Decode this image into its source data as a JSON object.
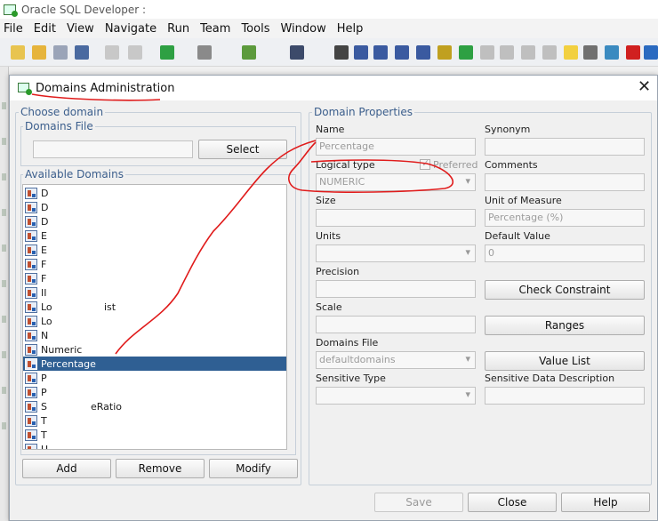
{
  "window": {
    "title": "Oracle SQL Developer :"
  },
  "menu": [
    "File",
    "Edit",
    "View",
    "Navigate",
    "Run",
    "Team",
    "Tools",
    "Window",
    "Help"
  ],
  "toolbar_icons": [
    {
      "name": "new-icon",
      "color": "#e8c450"
    },
    {
      "name": "open-icon",
      "color": "#e6b43c"
    },
    {
      "name": "save-icon",
      "color": "#9aa4b8"
    },
    {
      "name": "save-all-icon",
      "color": "#4a6aa0"
    },
    {
      "name": "undo-icon",
      "color": "#c8c8c8"
    },
    {
      "name": "redo-icon",
      "color": "#c8c8c8"
    },
    {
      "name": "back-icon",
      "color": "#2ea043"
    },
    {
      "name": "forward-icon",
      "color": "#8a8a8a"
    },
    {
      "name": "sql-icon",
      "color": "#5c9a3c"
    },
    {
      "name": "binoculars-icon",
      "color": "#3c4a6a"
    },
    {
      "name": "cursor-icon",
      "color": "#444444"
    },
    {
      "name": "table-icon",
      "color": "#3a5aa0"
    },
    {
      "name": "view-icon",
      "color": "#3a5aa0"
    },
    {
      "name": "index-icon",
      "color": "#3a5aa0"
    },
    {
      "name": "sequence-icon",
      "color": "#3a5aa0"
    },
    {
      "name": "key-icon",
      "color": "#c0a020"
    },
    {
      "name": "arrow-right-icon",
      "color": "#2ea043"
    },
    {
      "name": "grey1-icon",
      "color": "#bfbfbf"
    },
    {
      "name": "grey2-icon",
      "color": "#bfbfbf"
    },
    {
      "name": "grey3-icon",
      "color": "#bfbfbf"
    },
    {
      "name": "grey4-icon",
      "color": "#bfbfbf"
    },
    {
      "name": "note-icon",
      "color": "#f2d040"
    },
    {
      "name": "rect-icon",
      "color": "#707070"
    },
    {
      "name": "image-icon",
      "color": "#3a8ac0"
    },
    {
      "name": "delete-icon",
      "color": "#d02020"
    },
    {
      "name": "double-left-icon",
      "color": "#2a6ac0"
    },
    {
      "name": "zoom-in-icon",
      "color": "#2a5aa0"
    },
    {
      "name": "zoom-out-icon",
      "color": "#2a5aa0"
    }
  ],
  "dialog": {
    "title": "Domains Administration",
    "choose_domain": "Choose domain",
    "domains_file_group": "Domains File",
    "select_button": "Select",
    "available_domains": "Available Domains",
    "domains": [
      {
        "label": "D",
        "suffix": ""
      },
      {
        "label": "D",
        "suffix": ""
      },
      {
        "label": "D",
        "suffix": ""
      },
      {
        "label": "E",
        "suffix": ""
      },
      {
        "label": "E",
        "suffix": ""
      },
      {
        "label": "F",
        "suffix": ""
      },
      {
        "label": "F",
        "suffix": ""
      },
      {
        "label": "II",
        "suffix": ""
      },
      {
        "label": "Lo",
        "suffix": "ist"
      },
      {
        "label": "Lo",
        "suffix": ""
      },
      {
        "label": "N",
        "suffix": ""
      },
      {
        "label": "Numeric",
        "suffix": ""
      },
      {
        "label": "Percentage",
        "suffix": "",
        "selected": true
      },
      {
        "label": "P",
        "suffix": ""
      },
      {
        "label": "P",
        "suffix": ""
      },
      {
        "label": "S",
        "suffix": "eRatio"
      },
      {
        "label": "T",
        "suffix": ""
      },
      {
        "label": "T",
        "suffix": ""
      },
      {
        "label": "U",
        "suffix": ""
      }
    ],
    "add": "Add",
    "remove": "Remove",
    "modify": "Modify",
    "properties": {
      "group": "Domain Properties",
      "name_label": "Name",
      "name_value": "Percentage",
      "synonym_label": "Synonym",
      "logical_type_label": "Logical type",
      "preferred_label": "Preferred",
      "logical_type_value": "NUMERIC",
      "comments_label": "Comments",
      "size_label": "Size",
      "unit_label": "Unit of Measure",
      "unit_value": "Percentage (%)",
      "units_label": "Units",
      "default_label": "Default Value",
      "default_value": "0",
      "precision_label": "Precision",
      "check_constraint": "Check Constraint",
      "scale_label": "Scale",
      "ranges": "Ranges",
      "domains_file_label": "Domains File",
      "domains_file_value": "defaultdomains",
      "value_list": "Value List",
      "sensitive_type_label": "Sensitive Type",
      "sensitive_desc_label": "Sensitive Data Description"
    },
    "save": "Save",
    "close": "Close",
    "help": "Help"
  },
  "annotation_color": "#e01b1b"
}
